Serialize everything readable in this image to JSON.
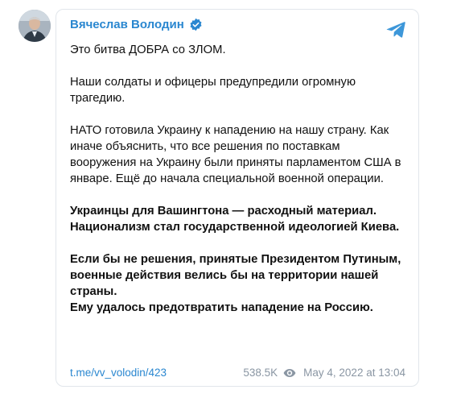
{
  "post": {
    "author": "Вячеслав Володин",
    "paragraphs": [
      {
        "text": "Это битва ДОБРА со ЗЛОМ.",
        "bold": false
      },
      {
        "text": "Наши солдаты и офицеры предупредили огромную трагедию.",
        "bold": false
      },
      {
        "text": "НАТО готовила Украину к нападению на нашу страну. Как иначе объяснить, что все решения по поставкам вооружения на Украину были приняты парламентом США в январе. Ещё до начала специальной военной операции.",
        "bold": false
      },
      {
        "text": "Украинцы для Вашингтона — расходный материал. Национализм стал государственной идеологией Киева.",
        "bold": true
      },
      {
        "text": "Если бы не решения, принятые Президентом Путиным, военные действия велись бы на территории нашей страны.\nЕму удалось предотвратить нападение на Россию.",
        "bold": true
      }
    ],
    "link": "t.me/vv_volodin/423",
    "views": "538.5K",
    "date": "May 4, 2022 at 13:04"
  },
  "icons": {
    "avatar": "avatar-photo",
    "verified": "verified-badge-icon",
    "source": "telegram-icon",
    "views": "eye-icon"
  },
  "colors": {
    "accent": "#2a87d0",
    "meta": "#8a96a3",
    "border": "#e1e6eb"
  }
}
